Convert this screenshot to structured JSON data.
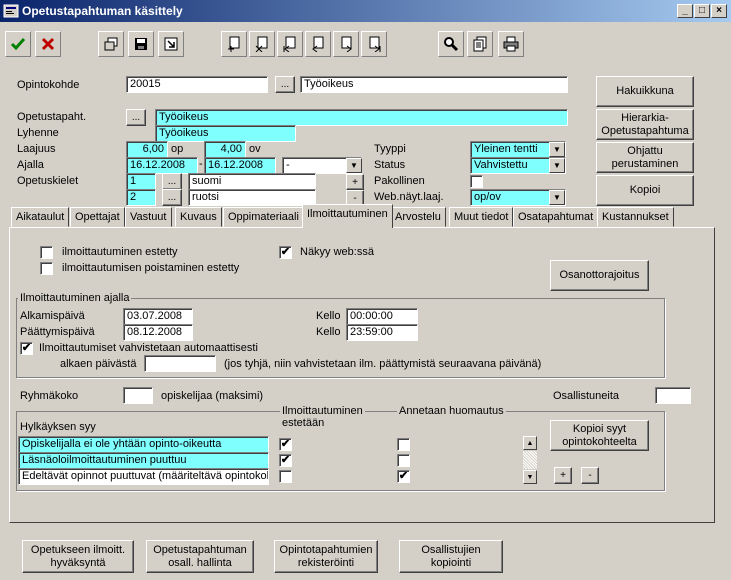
{
  "window": {
    "title": "Opetustapahtuman käsittely",
    "minimize": "_",
    "maximize": "□",
    "close": "×"
  },
  "toolbar": {
    "accent_ok": "#008000",
    "accent_cancel": "#c00000"
  },
  "header": {
    "opintokohde_label": "Opintokohde",
    "opintokohde_code": "20015",
    "opintokohde_name": "Työoikeus",
    "opetustapaht_label": "Opetustapaht.",
    "opetustapaht_value": "Työoikeus",
    "lyhenne_label": "Lyhenne",
    "lyhenne_value": "Työoikeus",
    "laajuus_label": "Laajuus",
    "laajuus_op": "6,00",
    "laajuus_op_unit": "op",
    "laajuus_ov": "4,00",
    "laajuus_ov_unit": "ov",
    "ajalla_label": "Ajalla",
    "ajalla_start": "16.12.2008",
    "ajalla_dash": "-",
    "ajalla_end": "16.12.2008",
    "ajalla_select": "-",
    "opetuskielet_label": "Opetuskielet",
    "kieli1_code": "1",
    "kieli1_name": "suomi",
    "kieli2_code": "2",
    "kieli2_name": "ruotsi",
    "tyyppi_label": "Tyyppi",
    "tyyppi_value": "Yleinen tentti",
    "status_label": "Status",
    "status_value": "Vahvistettu",
    "pakollinen_label": "Pakollinen",
    "webnayt_label": "Web.näyt.laaj.",
    "webnayt_value": "op/ov",
    "dots": "...",
    "plus": "+",
    "minus": "-"
  },
  "side_buttons": {
    "hakuikkuna": "Hakuikkuna",
    "hierarkia": "Hierarkia-\nOpetustapahtuma",
    "ohjattu": "Ohjattu\nperustaminen",
    "kopioi": "Kopioi"
  },
  "tabs": [
    "Aikataulut",
    "Opettajat",
    "Vastuut",
    "Kuvaus",
    "Oppimateriaali",
    "Ilmoittautuminen",
    "Arvostelu",
    "Muut tiedot",
    "Osatapahtumat",
    "Kustannukset"
  ],
  "panel": {
    "estetty": "ilmoittautuminen estetty",
    "poistaminen": "ilmoittautumisen poistaminen estetty",
    "nakyy": "Näkyy web:ssä",
    "nakyy_checked": "✔",
    "osanottorajoitus": "Osanottorajoitus",
    "ajalla_group": "Ilmoittautuminen ajalla",
    "alkamispaiva_label": "Alkamispäivä",
    "alkamispaiva": "03.07.2008",
    "paattymispaiva_label": "Päättymispäivä",
    "paattymispaiva": "08.12.2008",
    "kello_label": "Kello",
    "kello1": "00:00:00",
    "kello2": "23:59:00",
    "auto_label": "Ilmoittautumiset vahvistetaan automaattisesti",
    "auto_checked": "✔",
    "alkaen_label": "alkaen päivästä",
    "alkaen_note": "(jos tyhjä, niin vahvistetaan ilm. päättymistä seuraavana päivänä)",
    "ryhmakoko_label": "Ryhmäkoko",
    "opiskelijaa_label": "opiskelijaa (maksimi)",
    "osallistuneita_label": "Osallistuneita",
    "hylkays_label": "Hylkäyksen syy",
    "ilm_estetaan_label": "Ilmoittautuminen\nestetään",
    "huomautus_label": "Annetaan huomautus",
    "kopioi_syyt": "Kopioi syyt\nopintokohteelta",
    "rows": [
      {
        "text": "Opiskelijalla ei ole yhtään opinto-oikeutta",
        "estetaan": "✔",
        "huomautus": ""
      },
      {
        "text": "Läsnäoloilmoittautuminen puuttuu",
        "estetaan": "✔",
        "huomautus": ""
      },
      {
        "text": "Edeltävät opinnot puuttuvat (määriteltävä opintokoht",
        "estetaan": "",
        "huomautus": "✔"
      }
    ]
  },
  "bottom_buttons": {
    "b1": "Opetukseen ilmoitt.\nhyväksyntä",
    "b2": "Opetustapahtuman\nosall. hallinta",
    "b3": "Opintotapahtumien\nrekisteröinti",
    "b4": "Osallistujien\nkopiointi"
  }
}
